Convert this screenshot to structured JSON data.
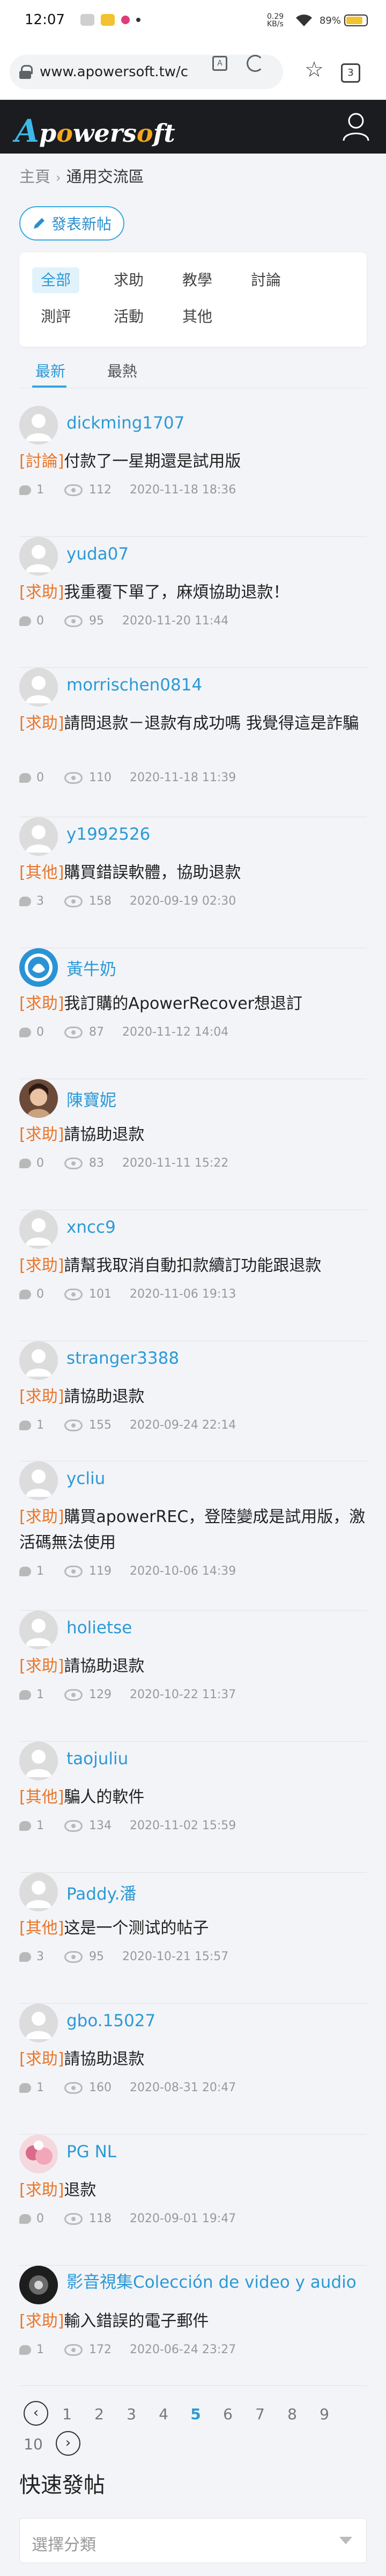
{
  "status_bar": {
    "time": "12:07",
    "signal_text": "0.29 KB/s",
    "battery_percent": "89%",
    "battery_level": 0.89
  },
  "browser": {
    "url": "www.apowersoft.tw/c",
    "tab_count": "3"
  },
  "site": {
    "logo_text": "Apowersoft"
  },
  "breadcrumb": {
    "home": "主頁",
    "separator": "›",
    "current": "通用交流區"
  },
  "new_post_button": "發表新帖",
  "categories": [
    "全部",
    "求助",
    "教學",
    "討論",
    "測評",
    "活動",
    "其他"
  ],
  "sort_tabs": [
    "最新",
    "最熱"
  ],
  "posts": [
    {
      "user": "dickming1707",
      "tag": "[討論]",
      "title": "付款了一星期還是試用版",
      "comments": "1",
      "views": "112",
      "date": "2020-11-18 18:36",
      "avatar": "default"
    },
    {
      "user": "yuda07",
      "tag": "[求助]",
      "title": "我重覆下單了，麻煩協助退款！",
      "comments": "0",
      "views": "95",
      "date": "2020-11-20 11:44",
      "avatar": "default"
    },
    {
      "user": "morrischen0814",
      "tag": "[求助]",
      "title": "請問退款－退款有成功嗎 我覺得這是詐騙",
      "comments": "0",
      "views": "110",
      "date": "2020-11-18 11:39",
      "avatar": "default"
    },
    {
      "user": "y1992526",
      "tag": "[其他]",
      "title": "購買錯誤軟體，協助退款",
      "comments": "3",
      "views": "158",
      "date": "2020-09-19 02:30",
      "avatar": "default"
    },
    {
      "user": "黃牛奶",
      "tag": "[求助]",
      "title": "我訂購的ApowerRecover想退訂",
      "comments": "0",
      "views": "87",
      "date": "2020-11-12 14:04",
      "avatar": "blue"
    },
    {
      "user": "陳寶妮",
      "tag": "[求助]",
      "title": "請協助退款",
      "comments": "0",
      "views": "83",
      "date": "2020-11-11 15:22",
      "avatar": "photo1"
    },
    {
      "user": "xncc9",
      "tag": "[求助]",
      "title": "請幫我取消自動扣款續訂功能跟退款",
      "comments": "0",
      "views": "101",
      "date": "2020-11-06 19:13",
      "avatar": "default"
    },
    {
      "user": "stranger3388",
      "tag": "[求助]",
      "title": "請協助退款",
      "comments": "1",
      "views": "155",
      "date": "2020-09-24 22:14",
      "avatar": "default"
    },
    {
      "user": "ycliu",
      "tag": "[求助]",
      "title": "購買apowerREC，登陸變成是試用版，激活碼無法使用",
      "comments": "1",
      "views": "119",
      "date": "2020-10-06 14:39",
      "avatar": "default"
    },
    {
      "user": "holietse",
      "tag": "[求助]",
      "title": "請協助退款",
      "comments": "1",
      "views": "129",
      "date": "2020-10-22 11:37",
      "avatar": "default"
    },
    {
      "user": "taojuliu",
      "tag": "[其他]",
      "title": "騙人的軟件",
      "comments": "1",
      "views": "134",
      "date": "2020-11-02 15:59",
      "avatar": "default"
    },
    {
      "user": "Paddy.潘",
      "tag": "[其他]",
      "title": "这是一个测试的帖子",
      "comments": "3",
      "views": "95",
      "date": "2020-10-21 15:57",
      "avatar": "default"
    },
    {
      "user": "gbo.15027",
      "tag": "[求助]",
      "title": "請協助退款",
      "comments": "1",
      "views": "160",
      "date": "2020-08-31 20:47",
      "avatar": "default"
    },
    {
      "user": "PG NL",
      "tag": "[求助]",
      "title": "退款",
      "comments": "0",
      "views": "118",
      "date": "2020-09-01 19:47",
      "avatar": "photo2"
    },
    {
      "user": "影音視集Colección de video y audio",
      "tag": "[求助]",
      "title": "輸入錯誤的電子郵件",
      "comments": "1",
      "views": "172",
      "date": "2020-06-24 23:27",
      "avatar": "photo3"
    }
  ],
  "pagination": {
    "prev": "‹",
    "next": "›",
    "pages": [
      "1",
      "2",
      "3",
      "4",
      "5",
      "6",
      "7",
      "8",
      "9",
      "10"
    ],
    "current": "5"
  },
  "quick_post": {
    "title": "快速發帖",
    "category_placeholder": "選擇分類"
  }
}
